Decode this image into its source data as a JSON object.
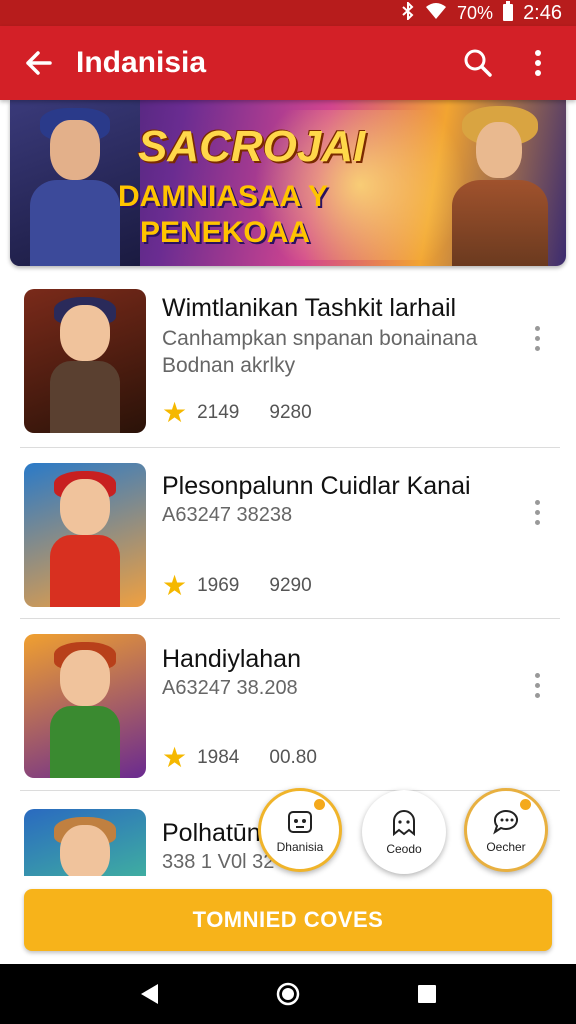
{
  "status_bar": {
    "battery": "70%",
    "time": "2:46",
    "icons": [
      "bluetooth-icon",
      "wifi-icon",
      "battery-icon"
    ]
  },
  "app_bar": {
    "title": "Indanisia",
    "back_icon": "arrow-left-icon",
    "search_icon": "search-icon",
    "menu_icon": "more-vert-icon"
  },
  "banner": {
    "title": "SACROJAI",
    "line2": "DAMNIASAA Y",
    "line3": "PENEKOAA"
  },
  "games": [
    {
      "name": "Wimtlanikan Tashkit larhail",
      "desc_line1": "Canhampkan snpanan bonainana",
      "desc_line2": "Bodnan akrlky",
      "code": "",
      "rating": "2149",
      "count": "9280",
      "theme": "dark"
    },
    {
      "name": "Plesonpalunn Cuidlar Kanai",
      "desc_line1": "",
      "desc_line2": "",
      "code": "A63247    38238",
      "rating": "1969",
      "count": "9290",
      "theme": "blue"
    },
    {
      "name": "Handiylahan",
      "desc_line1": "",
      "desc_line2": "",
      "code": "A63247    38.208",
      "rating": "1984",
      "count": "00.80",
      "theme": "orange"
    },
    {
      "name": "Polhatūn",
      "desc_line1": "",
      "desc_line2": "",
      "code": "338 1 V0l   32 306",
      "rating": "",
      "count": "",
      "theme": "teal"
    }
  ],
  "fabs": [
    {
      "label": "Dhanisia",
      "icon": "robot-face-icon"
    },
    {
      "label": "Ceodo",
      "icon": "ghost-chat-icon"
    },
    {
      "label": "Oecher",
      "icon": "chat-bubble-icon"
    }
  ],
  "cta": {
    "label": "TOMNIED COVES"
  },
  "colors": {
    "primary": "#d32027",
    "accent": "#f7b31a",
    "star": "#f5b800"
  }
}
